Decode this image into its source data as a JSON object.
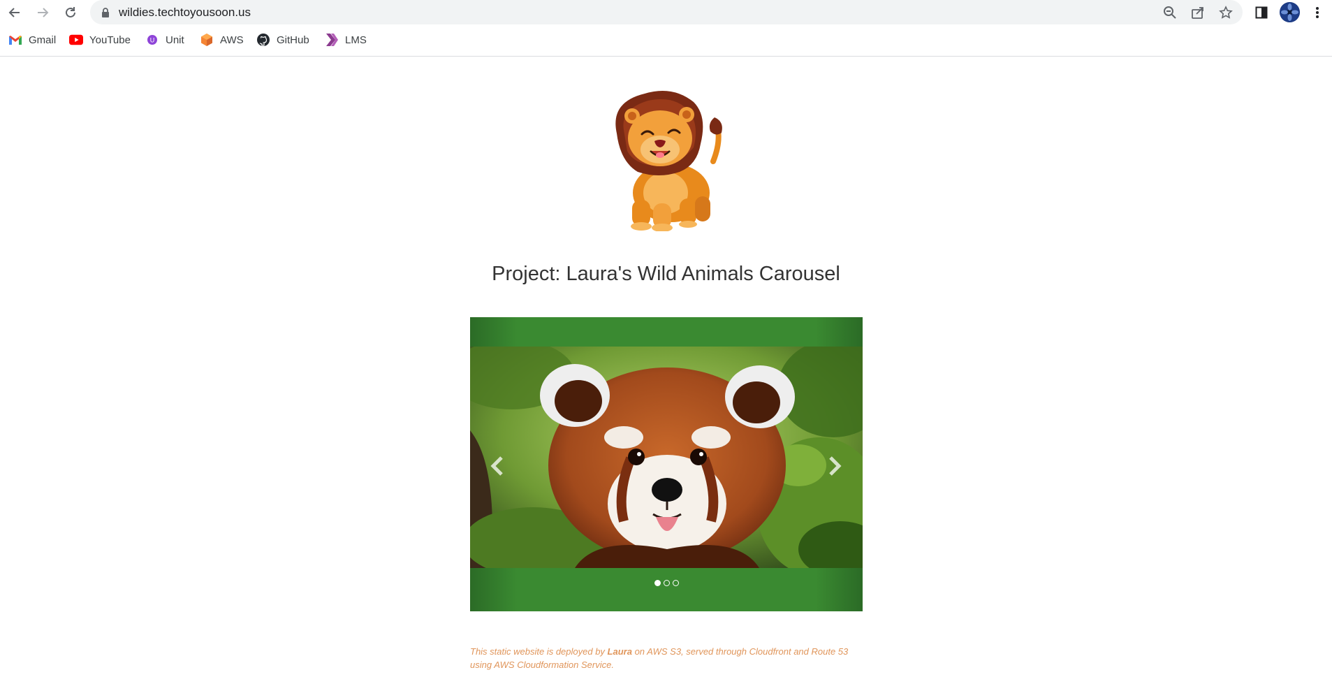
{
  "browser": {
    "url": "wildies.techtoyousoon.us",
    "bookmarks": [
      {
        "label": "Gmail",
        "icon": "gmail-icon"
      },
      {
        "label": "YouTube",
        "icon": "youtube-icon"
      },
      {
        "label": "Unit",
        "icon": "unit-icon"
      },
      {
        "label": "AWS",
        "icon": "aws-icon"
      },
      {
        "label": "GitHub",
        "icon": "github-icon"
      },
      {
        "label": "LMS",
        "icon": "lms-icon"
      }
    ]
  },
  "page": {
    "title": "Project: Laura's Wild Animals Carousel",
    "carousel": {
      "active_index": 0,
      "slide_count": 3,
      "slide_subject": "red panda"
    },
    "footer": {
      "text_1": "This static website is deployed by ",
      "author": "Laura",
      "text_2": " on AWS S3, served through Cloudfront and Route 53 using AWS Cloudformation Service."
    }
  },
  "colors": {
    "carousel_green": "#3a8a31",
    "footer_text": "#e0955a",
    "title_text": "#333333"
  }
}
